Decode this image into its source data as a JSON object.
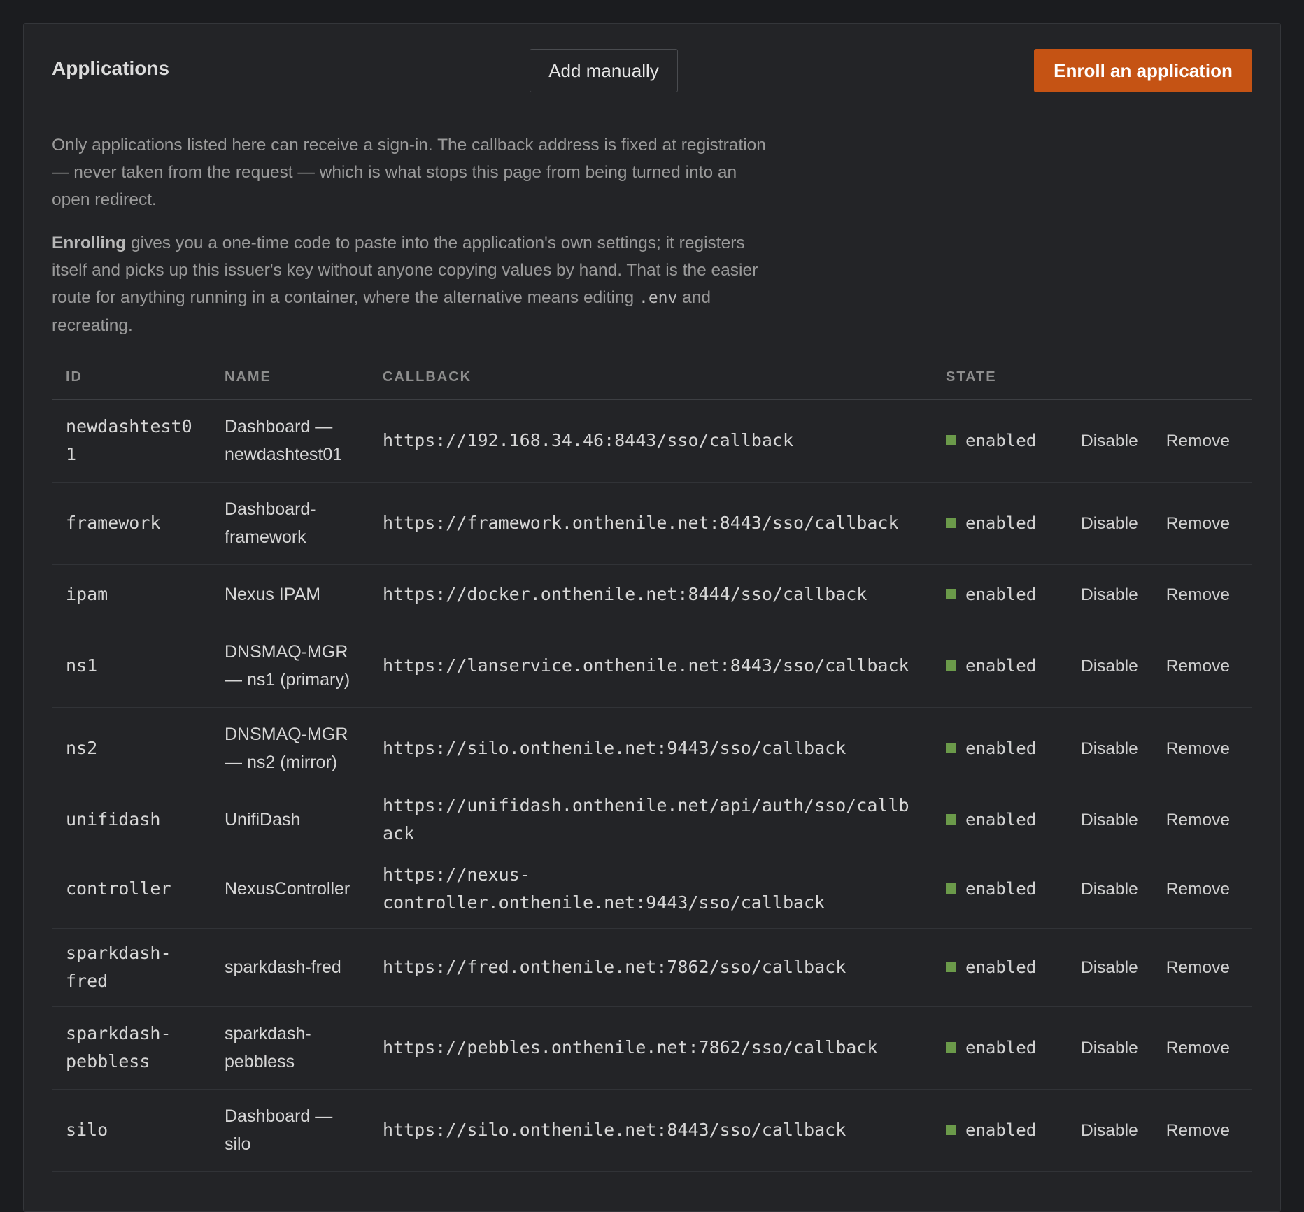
{
  "header": {
    "title": "Applications",
    "add_manually_label": "Add manually",
    "enroll_label": "Enroll an application"
  },
  "description": {
    "paragraph1": "Only applications listed here can receive a sign-in. The callback address is fixed at registration — never taken from the request — which is what stops this page from being turned into an open redirect.",
    "paragraph2_bold": "Enrolling",
    "paragraph2_text": " gives you a one-time code to paste into the application's own settings; it registers itself and picks up this issuer's key without anyone copying values by hand. That is the easier route for anything running in a container, where the alternative means editing ",
    "paragraph2_code": ".env",
    "paragraph2_end": " and recreating."
  },
  "table": {
    "columns": [
      "ID",
      "NAME",
      "CALLBACK",
      "STATE"
    ],
    "disable_label": "Disable",
    "remove_label": "Remove",
    "state_color": "#6b9a4a",
    "rows": [
      {
        "id": "newdashtest01",
        "name": "Dashboard — newdashtest01",
        "callback": "https://192.168.34.46:8443/sso/callback",
        "state": "enabled"
      },
      {
        "id": "framework",
        "name": "Dashboard-framework",
        "callback": "https://framework.onthenile.net:8443/sso/callback",
        "state": "enabled"
      },
      {
        "id": "ipam",
        "name": "Nexus IPAM",
        "callback": "https://docker.onthenile.net:8444/sso/callback",
        "state": "enabled"
      },
      {
        "id": "ns1",
        "name": "DNSMAQ-MGR — ns1 (primary)",
        "callback": "https://lanservice.onthenile.net:8443/sso/callback",
        "state": "enabled"
      },
      {
        "id": "ns2",
        "name": "DNSMAQ-MGR — ns2 (mirror)",
        "callback": "https://silo.onthenile.net:9443/sso/callback",
        "state": "enabled"
      },
      {
        "id": "unifidash",
        "name": "UnifiDash",
        "callback": "https://unifidash.onthenile.net/api/auth/sso/callback",
        "state": "enabled"
      },
      {
        "id": "controller",
        "name": "NexusController",
        "callback": "https://nexus-controller.onthenile.net:9443/sso/callback",
        "state": "enabled"
      },
      {
        "id": "sparkdash-fred",
        "name": "sparkdash-fred",
        "callback": "https://fred.onthenile.net:7862/sso/callback",
        "state": "enabled"
      },
      {
        "id": "sparkdash-pebbless",
        "name": "sparkdash-pebbless",
        "callback": "https://pebbles.onthenile.net:7862/sso/callback",
        "state": "enabled"
      },
      {
        "id": "silo",
        "name": "Dashboard — silo",
        "callback": "https://silo.onthenile.net:8443/sso/callback",
        "state": "enabled"
      }
    ]
  }
}
